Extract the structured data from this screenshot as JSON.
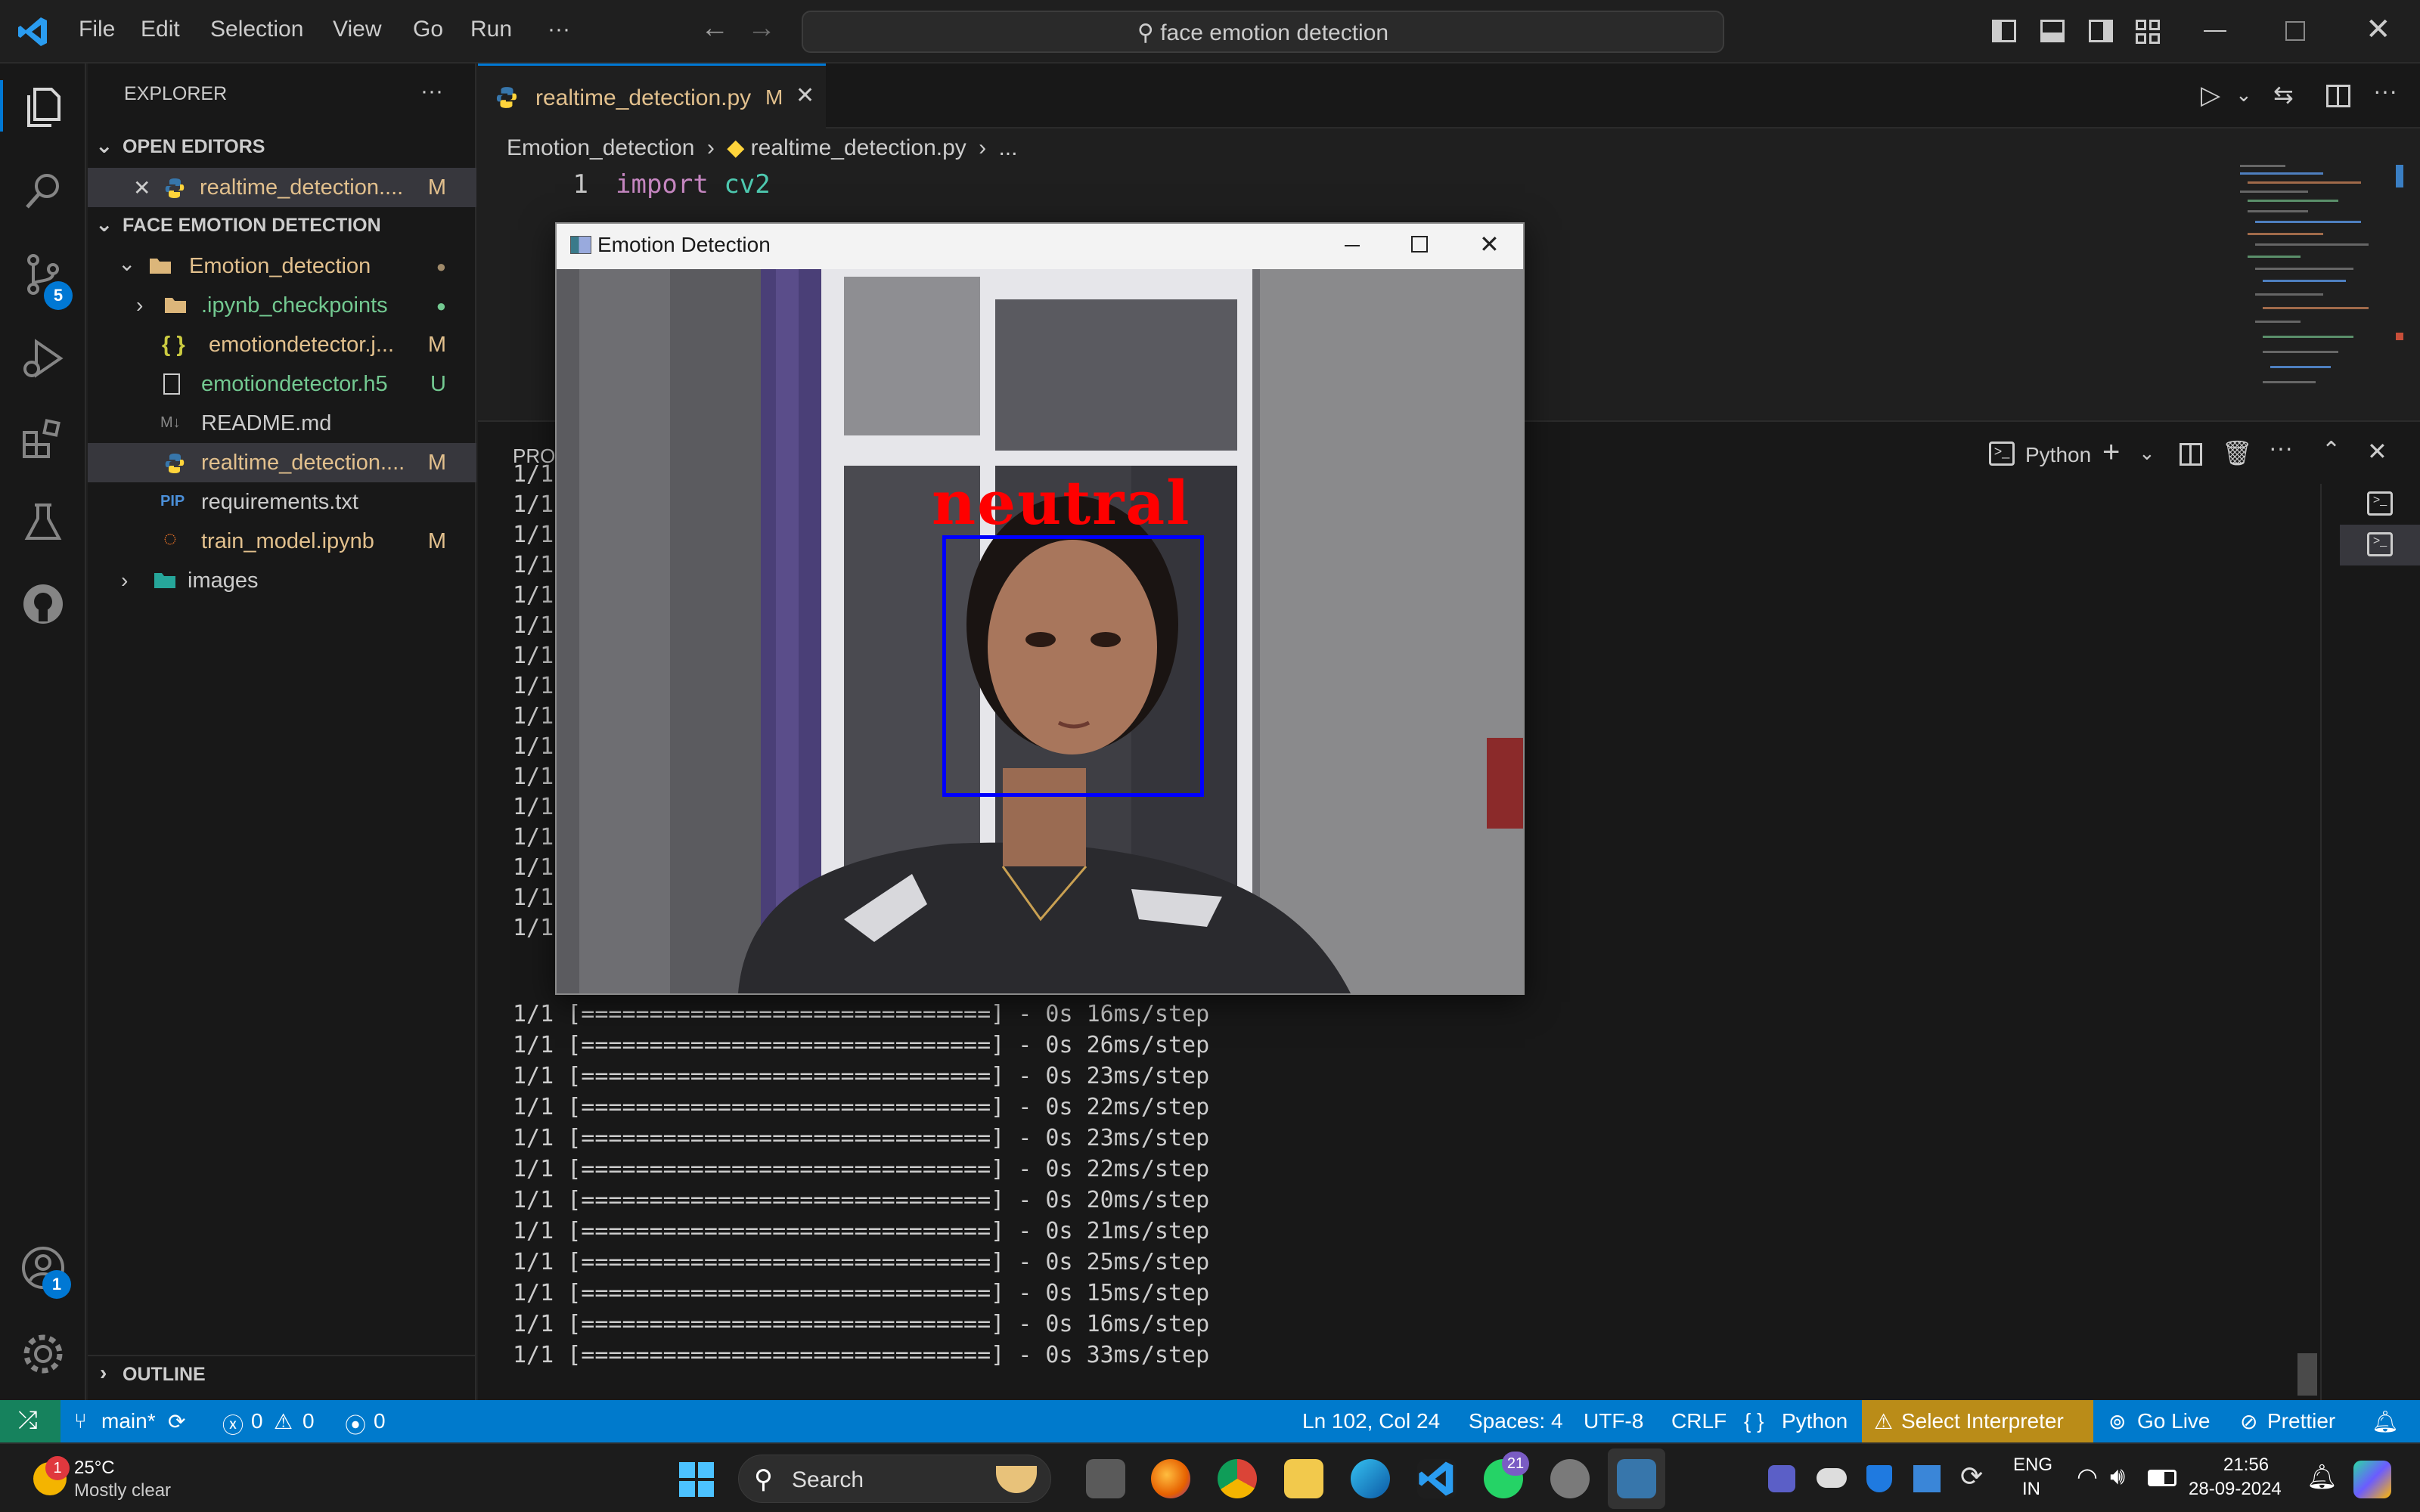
{
  "menu": [
    "File",
    "Edit",
    "Selection",
    "View",
    "Go",
    "Run",
    "···"
  ],
  "search": {
    "text": "face emotion detection"
  },
  "activity": {
    "source_control_badge": "5",
    "accounts_badge": "1"
  },
  "explorer": {
    "title": "EXPLORER",
    "open_editors_label": "OPEN EDITORS",
    "open_editor": {
      "name": "realtime_detection....",
      "status": "M"
    },
    "project_label": "FACE EMOTION DETECTION",
    "folder": "Emotion_detection",
    "files": [
      {
        "name": ".ipynb_checkpoints",
        "status": "●",
        "color": "#73c991"
      },
      {
        "name": "emotiondetector.j...",
        "status": "M",
        "color": "#e2c08d"
      },
      {
        "name": "emotiondetector.h5",
        "status": "U",
        "color": "#73c991"
      },
      {
        "name": "README.md",
        "status": "",
        "color": "#cccccc"
      },
      {
        "name": "realtime_detection....",
        "status": "M",
        "color": "#e2c08d"
      },
      {
        "name": "requirements.txt",
        "status": "",
        "color": "#cccccc"
      },
      {
        "name": "train_model.ipynb",
        "status": "M",
        "color": "#e2c08d"
      }
    ],
    "images_folder": "images",
    "outline_label": "OUTLINE"
  },
  "editor": {
    "tab_label": "realtime_detection.py",
    "tab_status": "M",
    "breadcrumb": [
      "Emotion_detection",
      "realtime_detection.py",
      "..."
    ],
    "line1_no": "1",
    "line1_kw": "import",
    "line1_mod": "cv2"
  },
  "panel": {
    "tab_label": "PROI",
    "terminal_profile": "Python",
    "hidden_prefix": "1/1",
    "lines": [
      "1/1 [==============================] - 0s 16ms/step",
      "1/1 [==============================] - 0s 26ms/step",
      "1/1 [==============================] - 0s 23ms/step",
      "1/1 [==============================] - 0s 22ms/step",
      "1/1 [==============================] - 0s 23ms/step",
      "1/1 [==============================] - 0s 22ms/step",
      "1/1 [==============================] - 0s 20ms/step",
      "1/1 [==============================] - 0s 21ms/step",
      "1/1 [==============================] - 0s 25ms/step",
      "1/1 [==============================] - 0s 15ms/step",
      "1/1 [==============================] - 0s 16ms/step",
      "1/1 [==============================] - 0s 33ms/step"
    ]
  },
  "emotion_window": {
    "title": "Emotion Detection",
    "label": "neutral",
    "label_color": "#ff0000",
    "box_color": "#0000ff"
  },
  "statusbar": {
    "branch": "main*",
    "errors": "0",
    "warnings": "0",
    "ports": "0",
    "position": "Ln 102, Col 24",
    "spaces": "Spaces: 4",
    "encoding": "UTF-8",
    "eol": "CRLF",
    "language": "Python",
    "interpreter": "Select Interpreter",
    "golive": "Go Live",
    "prettier": "Prettier"
  },
  "taskbar": {
    "weather_temp": "25°C",
    "weather_desc": "Mostly clear",
    "weather_badge": "1",
    "search": "Search",
    "whatsapp_badge": "21",
    "lang": "ENG",
    "region": "IN",
    "time": "21:56",
    "date": "28-09-2024"
  },
  "colors": {
    "accent": "#007acc",
    "modified": "#e2c08d",
    "untracked": "#73c991",
    "keyword": "#c586c0",
    "module": "#4ec9b0"
  }
}
